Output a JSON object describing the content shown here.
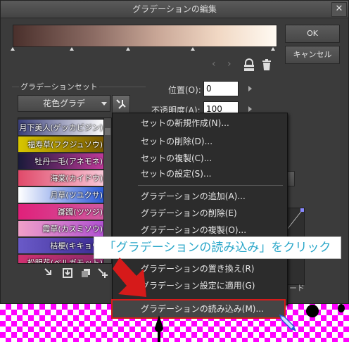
{
  "window": {
    "title": "グラデーションの編集",
    "close_glyph": "✕"
  },
  "buttons": {
    "ok": "OK",
    "cancel": "キャンセル"
  },
  "preset_group": {
    "label": "グラデーションセット",
    "selected": "花色グラデ",
    "items": [
      {
        "label": "月下美人(ゲッカビジン)",
        "colors": [
          "#3a3f7a",
          "#ffffff"
        ]
      },
      {
        "label": "福寿草(フクジュソウ)",
        "colors": [
          "#d8c600",
          "#7a5a00"
        ]
      },
      {
        "label": "牡丹一毛(アネモネ)",
        "colors": [
          "#1a1a3a",
          "#c0389a"
        ]
      },
      {
        "label": "海棠(カイドウ)",
        "colors": [
          "#e04a6a",
          "#f8c8d8"
        ]
      },
      {
        "label": "月草(ツユクサ)",
        "colors": [
          "#ffffff",
          "#2a5ad8"
        ]
      },
      {
        "label": "躑躅(ツツジ)",
        "colors": [
          "#e0207a",
          "#d05aa0"
        ]
      },
      {
        "label": "霞草(カスミソウ)",
        "colors": [
          "#f0a0c8",
          "#b050d0"
        ]
      },
      {
        "label": "桔梗(キキョウ)",
        "colors": [
          "#6a5ac8",
          "#3a2a90"
        ]
      },
      {
        "label": "松明花(ベルガモット)",
        "colors": [
          "#d03070",
          "#8a2a6a"
        ]
      }
    ]
  },
  "params": {
    "position_label": "位置(O):",
    "position_value": "0",
    "opacity_label": "不透明度(A):",
    "opacity_value": "100"
  },
  "context_menu": {
    "group1": [
      "セットの新規作成(N)...",
      "セットの削除(D)...",
      "セットの複製(C)...",
      "セットの設定(S)..."
    ],
    "group2": [
      "グラデーションの追加(A)...",
      "グラデーションの削除(E)",
      "グラデーションの複製(O)..."
    ],
    "group3": [
      "グラデーションの置き換え(R)",
      "グラデーション設定に適用(G)"
    ],
    "highlighted": "グラデーションの読み込み(M)..."
  },
  "obscured_label": "ード",
  "callout": "「グラデーションの読み込み」をクリック",
  "accent_colors": {
    "highlight_border": "#d61a1a",
    "callout_text": "#2aa7c9",
    "arrow": "#d61a1a"
  }
}
